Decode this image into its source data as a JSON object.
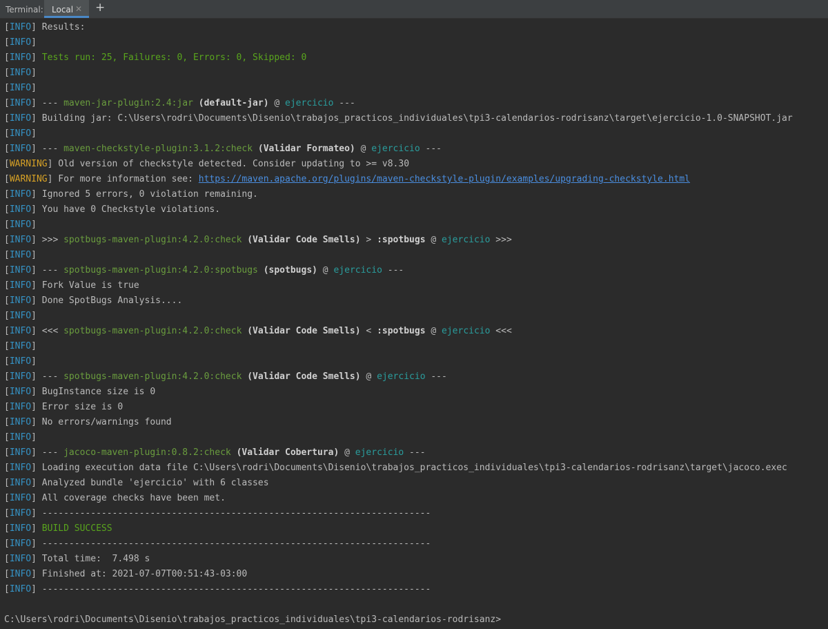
{
  "tabbar": {
    "title": "Terminal:",
    "tab_label": "Local",
    "close_glyph": "✕",
    "add_glyph": "+"
  },
  "colors": {
    "background": "#2b2b2b",
    "info": "#3592c4",
    "warning": "#d6a126",
    "success_green": "#59a51d",
    "plugin_green": "#6a9d3e",
    "project_teal": "#2a9d9d",
    "link_blue": "#4a8ee0"
  },
  "lines": [
    {
      "level": "INFO",
      "segments": [
        {
          "t": "Results:",
          "s": "default"
        }
      ]
    },
    {
      "level": "INFO",
      "segments": []
    },
    {
      "level": "INFO",
      "segments": [
        {
          "t": "Tests run: 25, Failures: 0, Errors: 0, Skipped: 0",
          "s": "green"
        }
      ]
    },
    {
      "level": "INFO",
      "segments": []
    },
    {
      "level": "INFO",
      "segments": []
    },
    {
      "level": "INFO",
      "segments": [
        {
          "t": "--- ",
          "s": "default"
        },
        {
          "t": "maven-jar-plugin:2.4:jar",
          "s": "plugin"
        },
        {
          "t": " ",
          "s": "default"
        },
        {
          "t": "(default-jar)",
          "s": "bold"
        },
        {
          "t": " @ ",
          "s": "default"
        },
        {
          "t": "ejercicio",
          "s": "project"
        },
        {
          "t": " ---",
          "s": "default"
        }
      ]
    },
    {
      "level": "INFO",
      "segments": [
        {
          "t": "Building jar: C:\\Users\\rodri\\Documents\\Disenio\\trabajos_practicos_individuales\\tpi3-calendarios-rodrisanz\\target\\ejercicio-1.0-SNAPSHOT.jar",
          "s": "default"
        }
      ]
    },
    {
      "level": "INFO",
      "segments": []
    },
    {
      "level": "INFO",
      "segments": [
        {
          "t": "--- ",
          "s": "default"
        },
        {
          "t": "maven-checkstyle-plugin:3.1.2:check",
          "s": "plugin"
        },
        {
          "t": " ",
          "s": "default"
        },
        {
          "t": "(Validar Formateo)",
          "s": "bold"
        },
        {
          "t": " @ ",
          "s": "default"
        },
        {
          "t": "ejercicio",
          "s": "project"
        },
        {
          "t": " ---",
          "s": "default"
        }
      ]
    },
    {
      "level": "WARNING",
      "segments": [
        {
          "t": "Old version of checkstyle detected. Consider updating to >= v8.30",
          "s": "default"
        }
      ]
    },
    {
      "level": "WARNING",
      "segments": [
        {
          "t": "For more information see: ",
          "s": "default"
        },
        {
          "t": "https://maven.apache.org/plugins/maven-checkstyle-plugin/examples/upgrading-checkstyle.html",
          "s": "link"
        }
      ]
    },
    {
      "level": "INFO",
      "segments": [
        {
          "t": "Ignored 5 errors, 0 violation remaining.",
          "s": "default"
        }
      ]
    },
    {
      "level": "INFO",
      "segments": [
        {
          "t": "You have 0 Checkstyle violations.",
          "s": "default"
        }
      ]
    },
    {
      "level": "INFO",
      "segments": []
    },
    {
      "level": "INFO",
      "segments": [
        {
          "t": ">>> ",
          "s": "default"
        },
        {
          "t": "spotbugs-maven-plugin:4.2.0:check",
          "s": "plugin"
        },
        {
          "t": " ",
          "s": "default"
        },
        {
          "t": "(Validar Code Smells)",
          "s": "bold"
        },
        {
          "t": " > ",
          "s": "default"
        },
        {
          "t": ":spotbugs",
          "s": "bold"
        },
        {
          "t": " @ ",
          "s": "default"
        },
        {
          "t": "ejercicio",
          "s": "project"
        },
        {
          "t": " >>>",
          "s": "default"
        }
      ]
    },
    {
      "level": "INFO",
      "segments": []
    },
    {
      "level": "INFO",
      "segments": [
        {
          "t": "--- ",
          "s": "default"
        },
        {
          "t": "spotbugs-maven-plugin:4.2.0:spotbugs",
          "s": "plugin"
        },
        {
          "t": " ",
          "s": "default"
        },
        {
          "t": "(spotbugs)",
          "s": "bold"
        },
        {
          "t": " @ ",
          "s": "default"
        },
        {
          "t": "ejercicio",
          "s": "project"
        },
        {
          "t": " ---",
          "s": "default"
        }
      ]
    },
    {
      "level": "INFO",
      "segments": [
        {
          "t": "Fork Value is true",
          "s": "default"
        }
      ]
    },
    {
      "level": "INFO",
      "segments": [
        {
          "t": "Done SpotBugs Analysis....",
          "s": "default"
        }
      ]
    },
    {
      "level": "INFO",
      "segments": []
    },
    {
      "level": "INFO",
      "segments": [
        {
          "t": "<<< ",
          "s": "default"
        },
        {
          "t": "spotbugs-maven-plugin:4.2.0:check",
          "s": "plugin"
        },
        {
          "t": " ",
          "s": "default"
        },
        {
          "t": "(Validar Code Smells)",
          "s": "bold"
        },
        {
          "t": " < ",
          "s": "default"
        },
        {
          "t": ":spotbugs",
          "s": "bold"
        },
        {
          "t": " @ ",
          "s": "default"
        },
        {
          "t": "ejercicio",
          "s": "project"
        },
        {
          "t": " <<<",
          "s": "default"
        }
      ]
    },
    {
      "level": "INFO",
      "segments": []
    },
    {
      "level": "INFO",
      "segments": []
    },
    {
      "level": "INFO",
      "segments": [
        {
          "t": "--- ",
          "s": "default"
        },
        {
          "t": "spotbugs-maven-plugin:4.2.0:check",
          "s": "plugin"
        },
        {
          "t": " ",
          "s": "default"
        },
        {
          "t": "(Validar Code Smells)",
          "s": "bold"
        },
        {
          "t": " @ ",
          "s": "default"
        },
        {
          "t": "ejercicio",
          "s": "project"
        },
        {
          "t": " ---",
          "s": "default"
        }
      ]
    },
    {
      "level": "INFO",
      "segments": [
        {
          "t": "BugInstance size is 0",
          "s": "default"
        }
      ]
    },
    {
      "level": "INFO",
      "segments": [
        {
          "t": "Error size is 0",
          "s": "default"
        }
      ]
    },
    {
      "level": "INFO",
      "segments": [
        {
          "t": "No errors/warnings found",
          "s": "default"
        }
      ]
    },
    {
      "level": "INFO",
      "segments": []
    },
    {
      "level": "INFO",
      "segments": [
        {
          "t": "--- ",
          "s": "default"
        },
        {
          "t": "jacoco-maven-plugin:0.8.2:check",
          "s": "plugin"
        },
        {
          "t": " ",
          "s": "default"
        },
        {
          "t": "(Validar Cobertura)",
          "s": "bold"
        },
        {
          "t": " @ ",
          "s": "default"
        },
        {
          "t": "ejercicio",
          "s": "project"
        },
        {
          "t": " ---",
          "s": "default"
        }
      ]
    },
    {
      "level": "INFO",
      "segments": [
        {
          "t": "Loading execution data file C:\\Users\\rodri\\Documents\\Disenio\\trabajos_practicos_individuales\\tpi3-calendarios-rodrisanz\\target\\jacoco.exec",
          "s": "default"
        }
      ]
    },
    {
      "level": "INFO",
      "segments": [
        {
          "t": "Analyzed bundle 'ejercicio' with 6 classes",
          "s": "default"
        }
      ]
    },
    {
      "level": "INFO",
      "segments": [
        {
          "t": "All coverage checks have been met.",
          "s": "default"
        }
      ]
    },
    {
      "level": "INFO",
      "segments": [
        {
          "t": "------------------------------------------------------------------------",
          "s": "default"
        }
      ]
    },
    {
      "level": "INFO",
      "segments": [
        {
          "t": "BUILD SUCCESS",
          "s": "green"
        }
      ]
    },
    {
      "level": "INFO",
      "segments": [
        {
          "t": "------------------------------------------------------------------------",
          "s": "default"
        }
      ]
    },
    {
      "level": "INFO",
      "segments": [
        {
          "t": "Total time:  7.498 s",
          "s": "default"
        }
      ]
    },
    {
      "level": "INFO",
      "segments": [
        {
          "t": "Finished at: 2021-07-07T00:51:43-03:00",
          "s": "default"
        }
      ]
    },
    {
      "level": "INFO",
      "segments": [
        {
          "t": "------------------------------------------------------------------------",
          "s": "default"
        }
      ]
    }
  ],
  "prompt": "C:\\Users\\rodri\\Documents\\Disenio\\trabajos_practicos_individuales\\tpi3-calendarios-rodrisanz>"
}
